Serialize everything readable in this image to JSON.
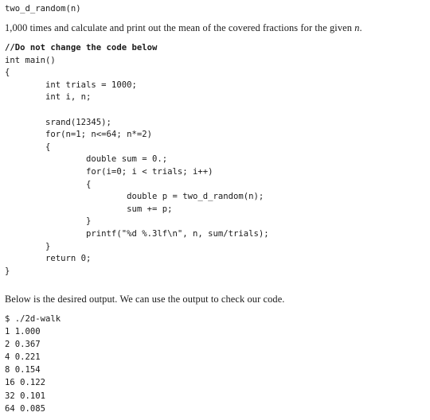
{
  "document": {
    "signature": "two_d_random(n)",
    "intro": {
      "count": "1,000",
      "text": " times and calculate and print out the mean of the covered fractions for the given ",
      "variable": "n",
      "period": "."
    },
    "code": {
      "lines": [
        "//Do not change the code below",
        "int main()",
        "{",
        "        int trials = 1000;",
        "        int i, n;",
        "",
        "        srand(12345);",
        "        for(n=1; n<=64; n*=2)",
        "        {",
        "                double sum = 0.;",
        "                for(i=0; i < trials; i++)",
        "                {",
        "                        double p = two_d_random(n);",
        "                        sum += p;",
        "                }",
        "                printf(\"%d %.3lf\\n\", n, sum/trials);",
        "        }",
        "        return 0;",
        "}"
      ],
      "bold_line_indices": [
        0
      ]
    },
    "output_note": "Below is the desired output.  We can use the output to check our code.",
    "terminal": {
      "command_line": "$ ./2d-walk",
      "results": [
        "1 1.000",
        "2 0.367",
        "4 0.221",
        "8 0.154",
        "16 0.122",
        "32 0.101",
        "64 0.085"
      ]
    }
  }
}
